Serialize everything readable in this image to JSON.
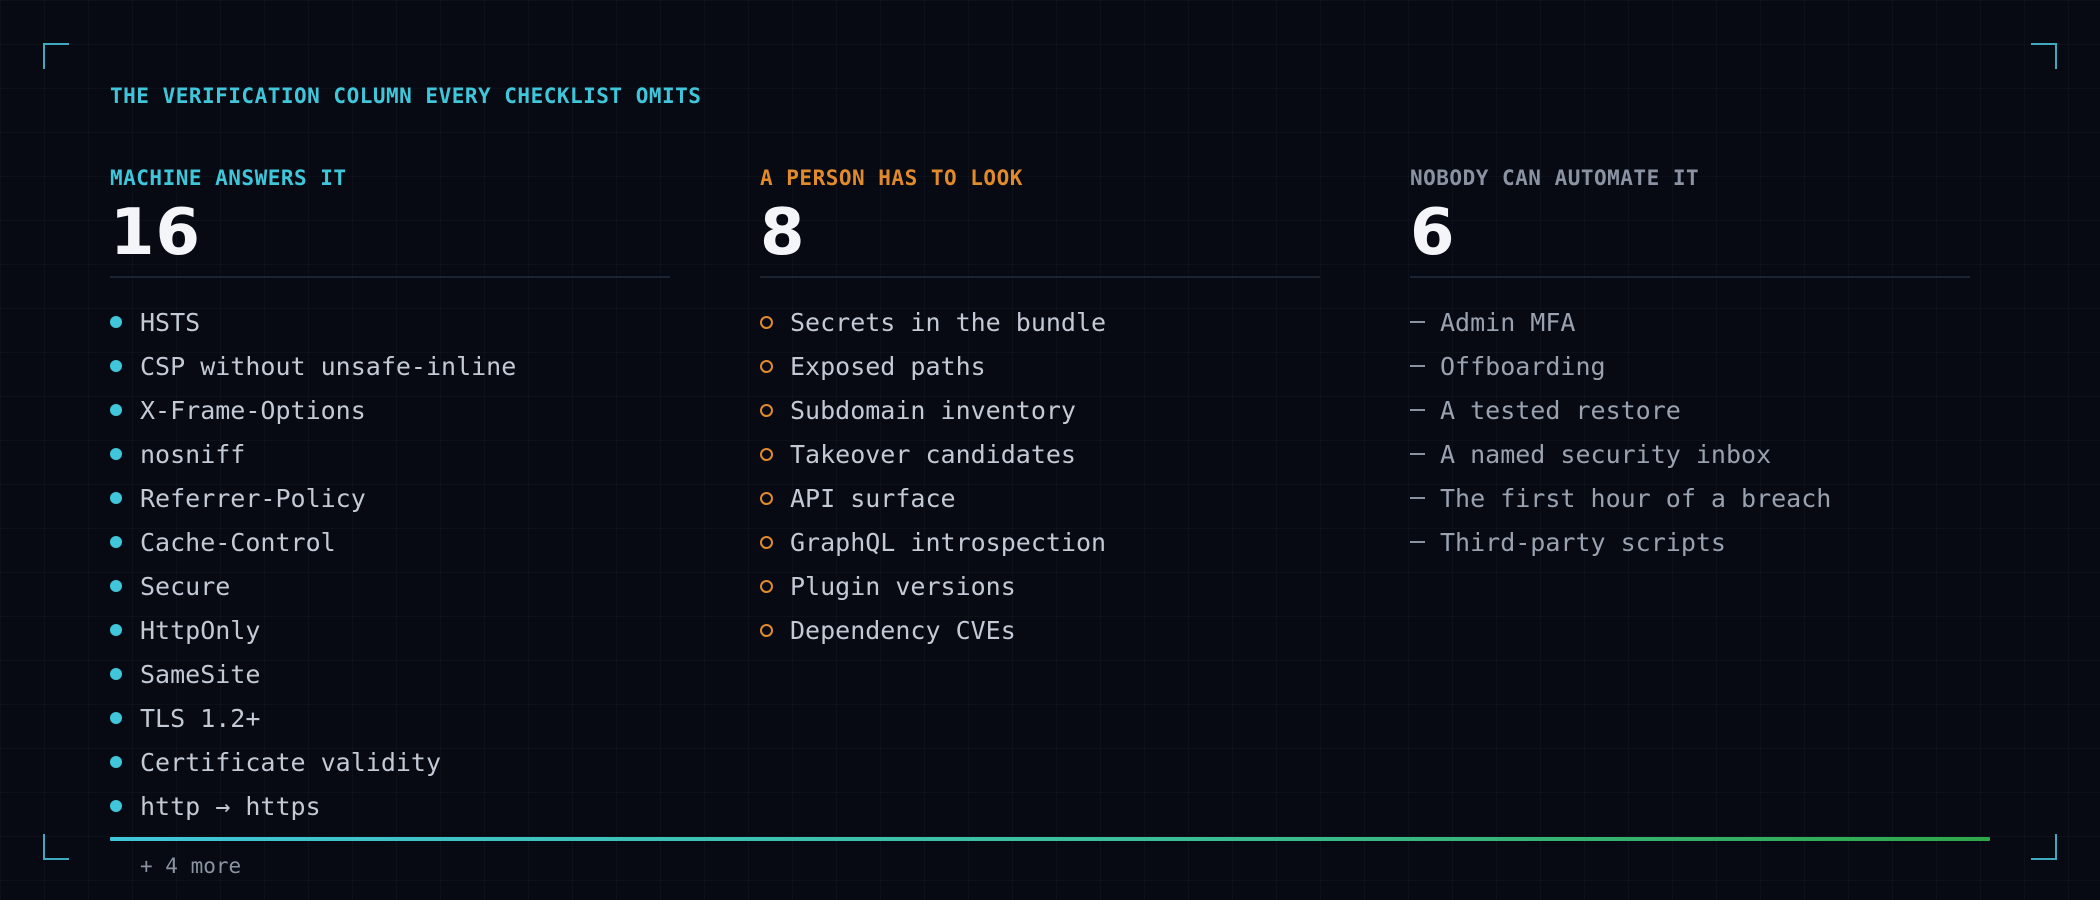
{
  "heading": "THE VERIFICATION COLUMN EVERY CHECKLIST OMITS",
  "columns": [
    {
      "label": "MACHINE ANSWERS IT",
      "count": "16",
      "accent": "#3fc6da",
      "marker_icon": "filled-dot-icon",
      "items": [
        "HSTS",
        "CSP without unsafe-inline",
        "X-Frame-Options",
        "nosniff",
        "Referrer-Policy",
        "Cache-Control",
        "Secure",
        "HttpOnly",
        "SameSite",
        "TLS 1.2+",
        "Certificate validity",
        "http → https"
      ],
      "more": "+ 4 more"
    },
    {
      "label": "A PERSON HAS TO LOOK",
      "count": "8",
      "accent": "#e08a2c",
      "marker_icon": "hollow-ring-icon",
      "items": [
        "Secrets in the bundle",
        "Exposed paths",
        "Subdomain inventory",
        "Takeover candidates",
        "API surface",
        "GraphQL introspection",
        "Plugin versions",
        "Dependency CVEs"
      ]
    },
    {
      "label": "NOBODY CAN AUTOMATE IT",
      "count": "6",
      "accent": "#8b93a3",
      "marker_icon": "dash-icon",
      "items": [
        "Admin MFA",
        "Offboarding",
        "A tested restore",
        "A named security inbox",
        "The first hour of a breach",
        "Third-party scripts"
      ]
    }
  ],
  "colors": {
    "background": "#070a12",
    "text": "#c3c9d5",
    "muted": "#8b93a3",
    "cyan": "#3fc6da",
    "orange": "#e08a2c",
    "green": "#2fa84a"
  }
}
